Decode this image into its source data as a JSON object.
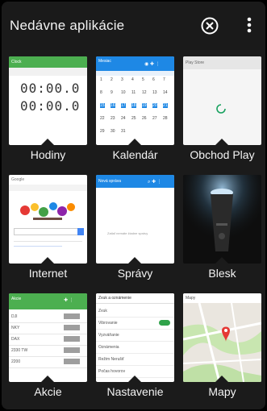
{
  "header": {
    "title": "Nedávne aplikácie",
    "close_icon": "close-circle-icon",
    "more_icon": "more-vert-icon"
  },
  "apps": [
    {
      "label": "Hodiny",
      "thumb": {
        "bar_color": "#4caf50",
        "bar_title": "Clock",
        "times": [
          "00:00.0",
          "00:00.0"
        ]
      }
    },
    {
      "label": "Kalendár",
      "thumb": {
        "bar_color": "#1e88e5",
        "bar_title": "Mesiac",
        "days": [
          "1",
          "2",
          "3",
          "4",
          "5",
          "6",
          "7",
          "8",
          "9",
          "10",
          "11",
          "12",
          "13",
          "14",
          "15",
          "16",
          "17",
          "18",
          "19",
          "20",
          "21",
          "22",
          "23",
          "24",
          "25",
          "26",
          "27",
          "28",
          "29",
          "30",
          "31"
        ]
      }
    },
    {
      "label": "Obchod Play",
      "thumb": {
        "bar_color": "#eeeeee",
        "bar_title": "Play Store"
      }
    },
    {
      "label": "Internet",
      "thumb": {
        "bar_color": "#ffffff",
        "bar_title": "Google"
      }
    },
    {
      "label": "Správy",
      "thumb": {
        "bar_color": "#1e88e5",
        "bar_title": "Nová správa",
        "body": "Zatiaľ nemáte žiadne správy"
      }
    },
    {
      "label": "Blesk",
      "thumb": {
        "bar_color": "#111111",
        "bar_title": ""
      }
    },
    {
      "label": "Akcie",
      "thumb": {
        "bar_color": "#4caf50",
        "bar_title": "Akcie",
        "rows": [
          "DJI",
          "NKY",
          "DAX",
          "2330 TW",
          "2200"
        ]
      }
    },
    {
      "label": "Nastavenie",
      "thumb": {
        "bar_color": "#ffffff",
        "bar_title": "Zvuk a oznámenie",
        "rows": [
          "Zvuk",
          "Vibrovanie",
          "Vyzváňanie",
          "Oznámenia",
          "Režim Nerušiť",
          "Počas hovorov"
        ]
      }
    },
    {
      "label": "Mapy",
      "thumb": {
        "bar_color": "#ffffff",
        "bar_title": "Mapy"
      }
    }
  ],
  "colors": {
    "background": "#1b1b1b",
    "clock_green": "#4caf50",
    "calendar_blue": "#1e88e5",
    "toggle_green": "#2fa24a"
  }
}
